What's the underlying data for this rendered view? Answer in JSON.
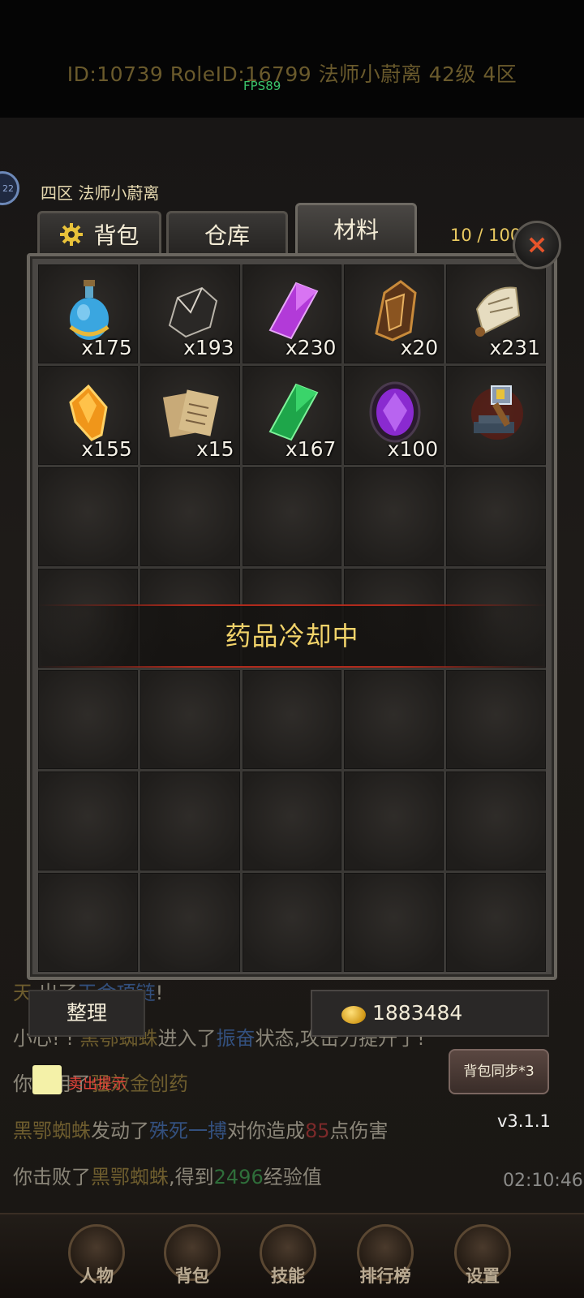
{
  "header": {
    "player_info": "ID:10739  RoleID:16799  法师小蔚离  42级  4区",
    "fps": "FPS89"
  },
  "character": {
    "server_name": "四区  法师小蔚离",
    "level_badge": "22"
  },
  "inventory": {
    "tabs": [
      {
        "label": "背包",
        "active": false
      },
      {
        "label": "仓库",
        "active": false
      },
      {
        "label": "材料",
        "active": true
      }
    ],
    "capacity": "10 / 100",
    "close_icon": "×",
    "slots": [
      {
        "icon": "potion-flask-icon",
        "qty": "x175"
      },
      {
        "icon": "dark-ore-icon",
        "qty": "x193"
      },
      {
        "icon": "purple-crystal-icon",
        "qty": "x230"
      },
      {
        "icon": "bronze-armor-shard-icon",
        "qty": "x20"
      },
      {
        "icon": "ancient-scroll-icon",
        "qty": "x231"
      },
      {
        "icon": "amber-crystal-icon",
        "qty": "x155"
      },
      {
        "icon": "paper-sheets-icon",
        "qty": "x15"
      },
      {
        "icon": "green-crystal-icon",
        "qty": "x167"
      },
      {
        "icon": "purple-gem-icon",
        "qty": "x100"
      },
      {
        "icon": "forge-hammer-icon",
        "qty": ""
      }
    ],
    "cooldown_message": "药品冷却中",
    "sort_button": "整理",
    "gold_amount": "1883484",
    "sell_hint_label": "卖出提示",
    "sync_button": "背包同步*3"
  },
  "chat": [
    {
      "parts": [
        {
          "t": "天",
          "c": "gold"
        },
        {
          "t": "                  "
        },
        {
          "t": "出了"
        },
        {
          "t": "天命项链",
          "c": "blue"
        },
        {
          "t": "!"
        }
      ]
    },
    {
      "parts": [
        {
          "t": "小心! ! "
        },
        {
          "t": "黑鄂蜘蛛",
          "c": "gold"
        },
        {
          "t": "进入了"
        },
        {
          "t": "振奋",
          "c": "blue"
        },
        {
          "t": "状态,攻击力提升了!"
        }
      ]
    },
    {
      "parts": [
        {
          "t": "你使用了"
        },
        {
          "t": "强效金创药",
          "c": "gold"
        }
      ]
    },
    {
      "parts": [
        {
          "t": "黑鄂蜘蛛",
          "c": "gold"
        },
        {
          "t": "发动了"
        },
        {
          "t": "殊死一搏",
          "c": "blue"
        },
        {
          "t": "对你造成"
        },
        {
          "t": "85",
          "c": "red"
        },
        {
          "t": "点伤害"
        }
      ]
    },
    {
      "parts": [
        {
          "t": "你击败了"
        },
        {
          "t": "黑鄂蜘蛛",
          "c": "gold"
        },
        {
          "t": ",得到"
        },
        {
          "t": "2496",
          "c": "green"
        },
        {
          "t": "经验值"
        }
      ]
    }
  ],
  "status": {
    "version": "v3.1.1",
    "clock": "02:10:46"
  },
  "bottom_nav": [
    {
      "label": "人物",
      "icon": "character-icon"
    },
    {
      "label": "背包",
      "icon": "bag-icon"
    },
    {
      "label": "技能",
      "icon": "skills-icon"
    },
    {
      "label": "排行榜",
      "icon": "ranking-icon"
    },
    {
      "label": "设置",
      "icon": "settings-icon"
    }
  ],
  "colors": {
    "accent_gold": "#e8c860",
    "close_red": "#e8542a",
    "cooldown_text": "#f2d36a",
    "fps_green": "#3bc46a"
  }
}
